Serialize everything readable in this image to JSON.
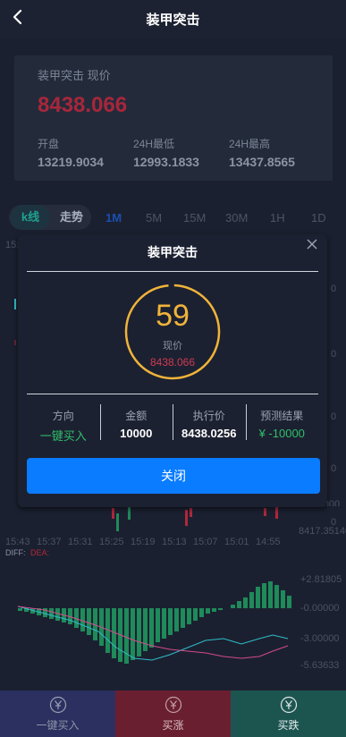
{
  "header": {
    "title": "装甲突击"
  },
  "ticker": {
    "name": "装甲突击 现价",
    "price": "8438.066",
    "open_label": "开盘",
    "open_value": "13219.9034",
    "low_label": "24H最低",
    "low_value": "12993.1833",
    "high_label": "24H最高",
    "high_value": "13437.8565"
  },
  "tabs": {
    "kline": "k线",
    "trend": "走势",
    "periods": [
      "1M",
      "5M",
      "15M",
      "30M",
      "1H",
      "1D"
    ],
    "active_period": "1M"
  },
  "chart": {
    "partial_left_label": "15:",
    "price_axis": [
      "0",
      "0",
      "0",
      "0",
      "0"
    ],
    "price_axis_bottom_partial": "8426.60000",
    "price_axis_bottom": "8417.35140",
    "time_axis": [
      "15:43",
      "15:37",
      "15:31",
      "15:25",
      "15:19",
      "15:13",
      "15:07",
      "15:01",
      "14:55"
    ],
    "macd_label": "DIFF:",
    "macd_dea_label": "DEA:",
    "macd_axis": [
      "+2.81805",
      "-0.00000",
      "-3.00000",
      "-5.63633"
    ],
    "colors": {
      "up": "#1f8a5a",
      "down": "#b0283c",
      "diff": "#d24b8c",
      "dea": "#2fbcc8"
    }
  },
  "modal": {
    "title": "装甲突击",
    "countdown": "59",
    "current_label": "现价",
    "current_value": "8438.066",
    "direction_label": "方向",
    "direction_value": "一键买入",
    "amount_label": "金额",
    "amount_value": "10000",
    "exec_label": "执行价",
    "exec_value": "8438.0256",
    "result_label": "预测结果",
    "result_value": "¥ -10000",
    "close_button": "关闭",
    "accent": "#f0b43a",
    "button_color": "#0a7cff"
  },
  "bottom": {
    "buy_label": "一键买入",
    "up_label": "买涨",
    "down_label": "买跌",
    "icon": "yen-circle-icon"
  }
}
